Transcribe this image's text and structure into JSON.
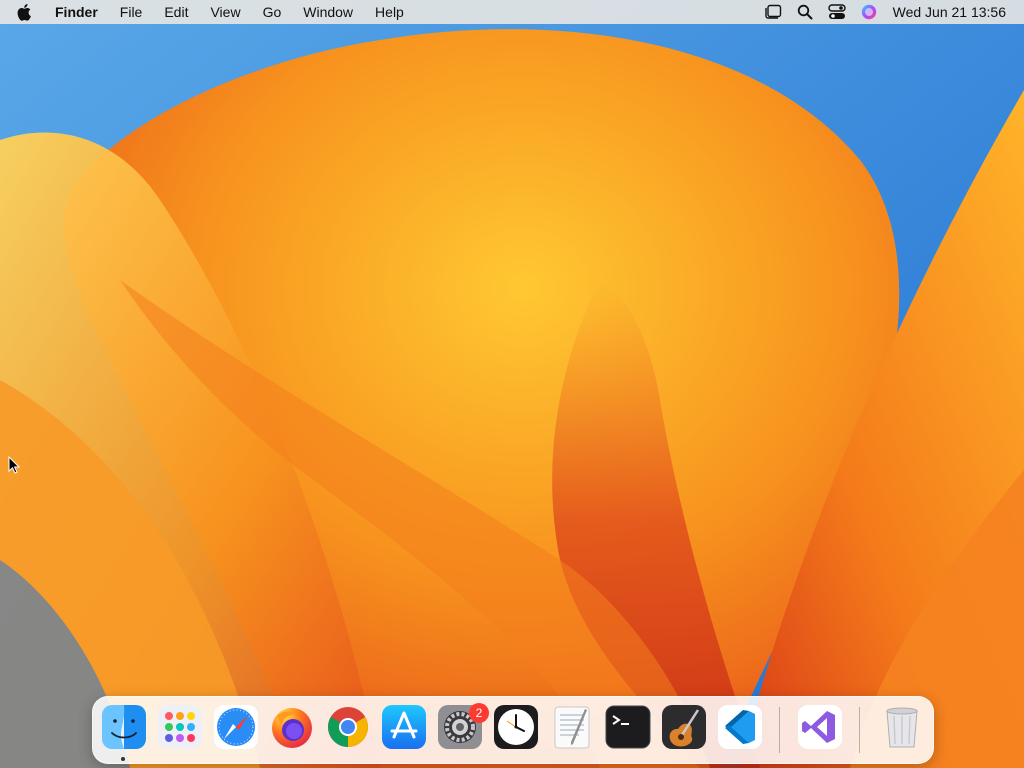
{
  "menubar": {
    "apple_menu_icon": "apple-icon",
    "app_name": "Finder",
    "menus": [
      "File",
      "Edit",
      "View",
      "Go",
      "Window",
      "Help"
    ],
    "status_icons": [
      "stage-manager-icon",
      "spotlight-search-icon",
      "control-center-icon",
      "siri-icon"
    ],
    "clock": "Wed Jun 21  13:56"
  },
  "dock": {
    "apps": [
      {
        "icon": "finder-icon",
        "running": true
      },
      {
        "icon": "launchpad-icon",
        "running": false
      },
      {
        "icon": "safari-icon",
        "running": false
      },
      {
        "icon": "firefox-icon",
        "running": false
      },
      {
        "icon": "chrome-icon",
        "running": false
      },
      {
        "icon": "app-store-icon",
        "running": false
      },
      {
        "icon": "system-settings-icon",
        "running": false,
        "badge": "2"
      },
      {
        "icon": "clock-icon",
        "running": false
      },
      {
        "icon": "textedit-icon",
        "running": false
      },
      {
        "icon": "terminal-icon",
        "running": false
      },
      {
        "icon": "garageband-icon",
        "running": false
      },
      {
        "icon": "vscode-icon",
        "running": false
      },
      {
        "icon": "visual-studio-icon",
        "running": false
      },
      {
        "icon": "trash-icon",
        "running": false
      }
    ]
  },
  "colors": {
    "wallpaper_blue": "#2f7fd6",
    "wallpaper_orange": "#f79a1e",
    "wallpaper_red": "#e0421c",
    "badge_red": "#ff3b30"
  }
}
